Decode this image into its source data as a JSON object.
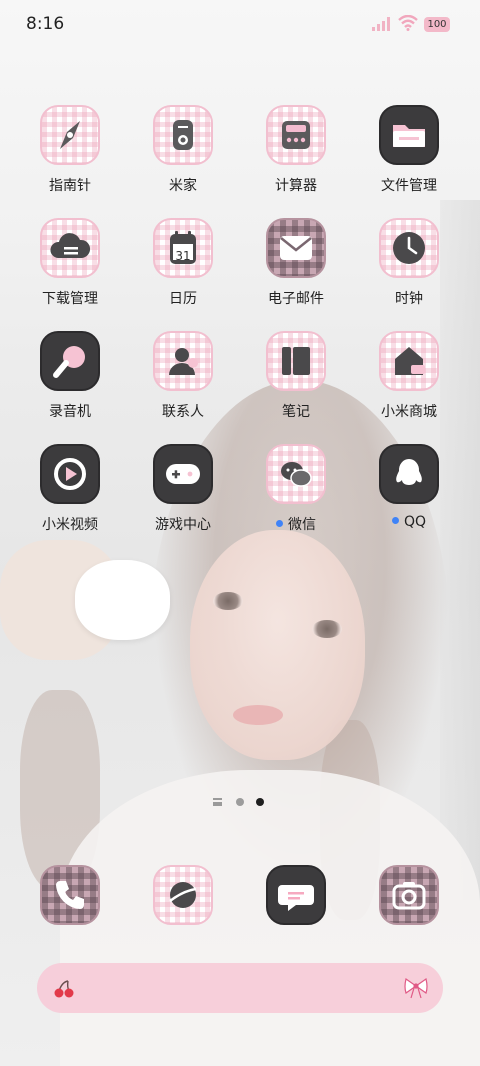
{
  "status_bar": {
    "time": "8:16",
    "battery": "100"
  },
  "apps_row1": [
    {
      "label": "指南针",
      "icon": "compass-icon"
    },
    {
      "label": "米家",
      "icon": "mijia-icon"
    },
    {
      "label": "计算器",
      "icon": "calculator-icon"
    },
    {
      "label": "文件管理",
      "icon": "folder-icon"
    }
  ],
  "apps_row2": [
    {
      "label": "下载管理",
      "icon": "cloud-download-icon"
    },
    {
      "label": "日历",
      "icon": "calendar-icon",
      "date": "31"
    },
    {
      "label": "电子邮件",
      "icon": "mail-icon"
    },
    {
      "label": "时钟",
      "icon": "clock-icon"
    }
  ],
  "apps_row3": [
    {
      "label": "录音机",
      "icon": "recorder-icon"
    },
    {
      "label": "联系人",
      "icon": "contacts-icon"
    },
    {
      "label": "笔记",
      "icon": "notes-icon"
    },
    {
      "label": "小米商城",
      "icon": "store-icon"
    }
  ],
  "apps_row4": [
    {
      "label": "小米视频",
      "icon": "video-play-icon"
    },
    {
      "label": "游戏中心",
      "icon": "gamepad-icon"
    },
    {
      "label": "微信",
      "icon": "wechat-icon",
      "new_dot": true
    },
    {
      "label": "QQ",
      "icon": "qq-icon",
      "new_dot": true
    }
  ],
  "dock": [
    {
      "icon": "phone-icon"
    },
    {
      "icon": "browser-icon"
    },
    {
      "icon": "message-icon"
    },
    {
      "icon": "camera-icon"
    }
  ],
  "colors": {
    "accent_pink": "#f7c8d6",
    "dark_icon": "#3c3b3d",
    "notify_dot": "#3f83f7"
  }
}
